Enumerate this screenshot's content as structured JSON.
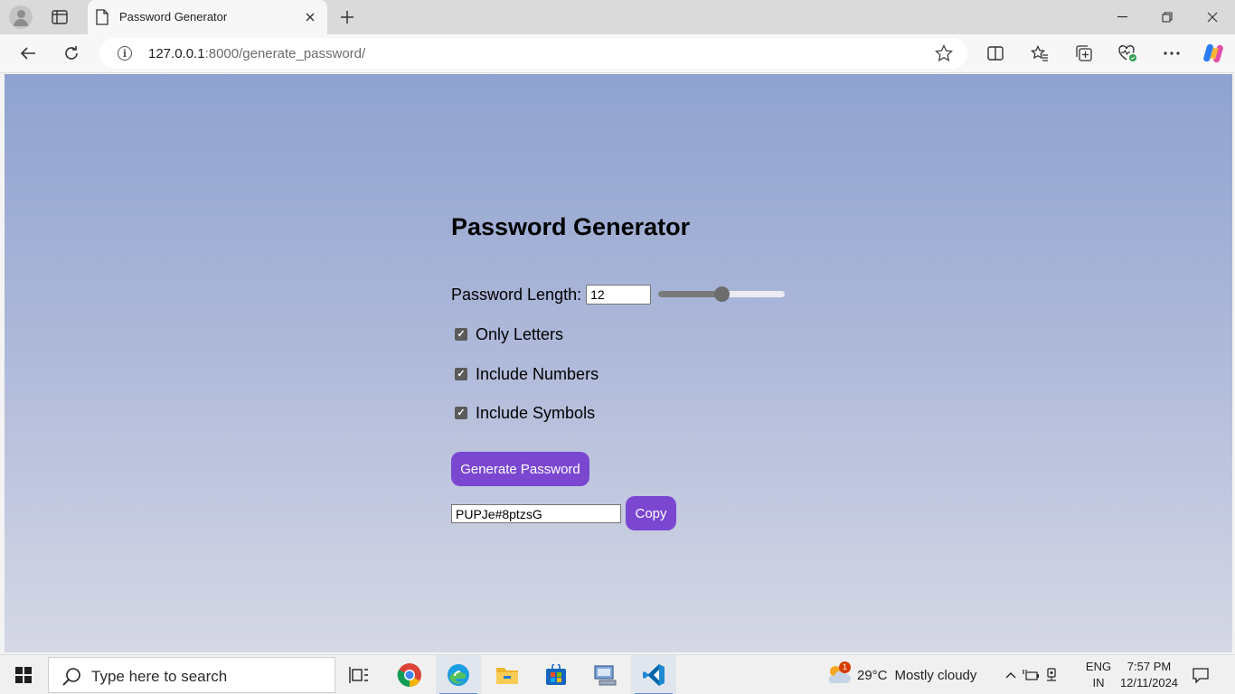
{
  "browser": {
    "tab_title": "Password Generator",
    "url_host": "127.0.0.1",
    "url_path": ":8000/generate_password/"
  },
  "page": {
    "title": "Password Generator",
    "length_label": "Password Length:",
    "length_value": "12",
    "slider": {
      "value_fraction": 0.5
    },
    "options": [
      {
        "label": "Only Letters",
        "checked": true
      },
      {
        "label": "Include Numbers",
        "checked": true
      },
      {
        "label": "Include Symbols",
        "checked": true
      }
    ],
    "generate_label": "Generate Password",
    "generated_password": "PUPJe#8ptzsG",
    "copy_label": "Copy",
    "accent_color": "#7b47d1"
  },
  "taskbar": {
    "search_placeholder": "Type here to search",
    "apps": [
      "task-view",
      "chrome",
      "edge",
      "file-explorer",
      "microsoft-store",
      "remote-desktop",
      "vscode"
    ],
    "weather_badge": "1",
    "weather_temp": "29°C",
    "weather_desc": "Mostly cloudy",
    "lang_top": "ENG",
    "lang_bottom": "IN",
    "time": "7:57 PM",
    "date": "12/11/2024"
  }
}
